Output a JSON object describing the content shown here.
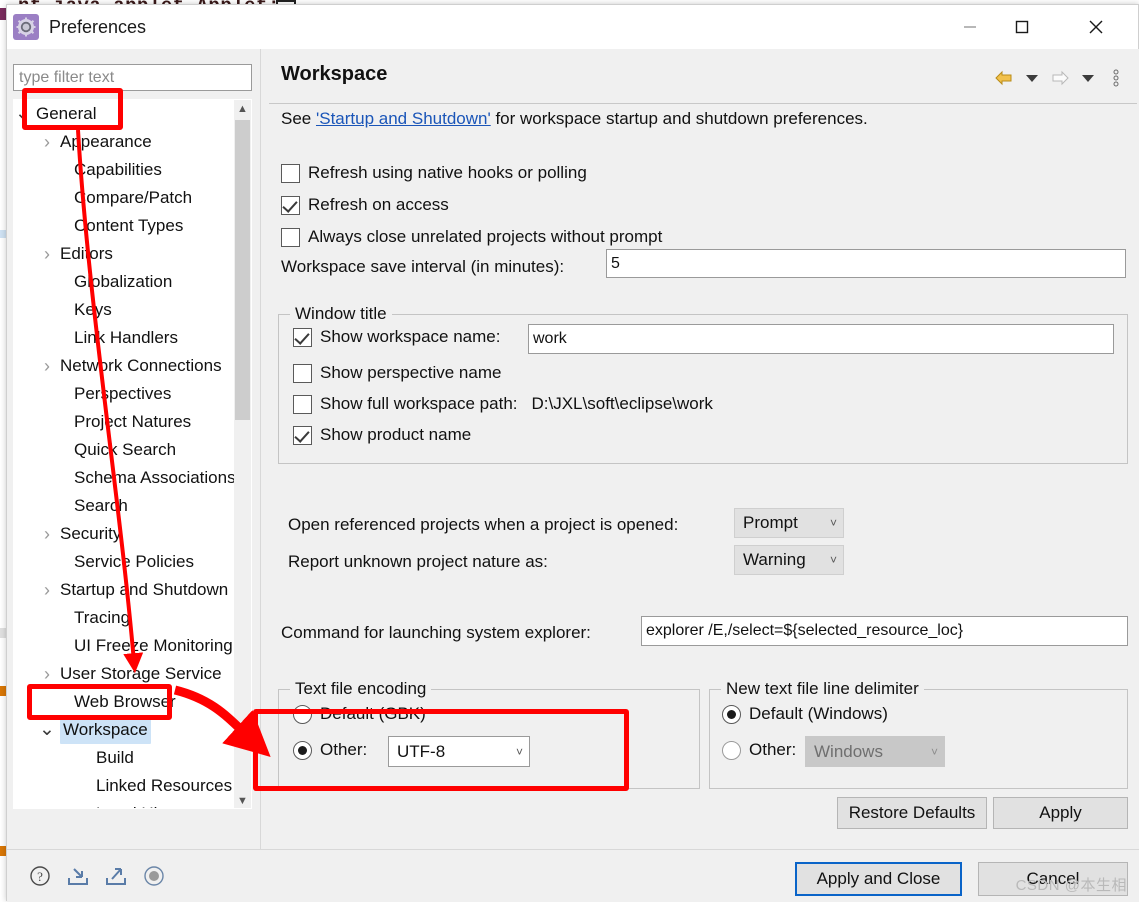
{
  "background": {
    "code_line": "nt java applet Applet;"
  },
  "window": {
    "title": "Preferences",
    "icon": "gear-icon",
    "minimize_label": "—",
    "maximize_label": "□",
    "close_label": "✕"
  },
  "sidebar": {
    "filter_placeholder": "type filter text",
    "filter_value": "",
    "items": [
      {
        "label": "General",
        "indent": 22,
        "twisty": "down",
        "selected": false
      },
      {
        "label": "Appearance",
        "indent": 46,
        "twisty": "right",
        "selected": false
      },
      {
        "label": "Capabilities",
        "indent": 60,
        "twisty": "none",
        "selected": false
      },
      {
        "label": "Compare/Patch",
        "indent": 60,
        "twisty": "none",
        "selected": false
      },
      {
        "label": "Content Types",
        "indent": 60,
        "twisty": "none",
        "selected": false
      },
      {
        "label": "Editors",
        "indent": 46,
        "twisty": "right",
        "selected": false
      },
      {
        "label": "Globalization",
        "indent": 60,
        "twisty": "none",
        "selected": false
      },
      {
        "label": "Keys",
        "indent": 60,
        "twisty": "none",
        "selected": false
      },
      {
        "label": "Link Handlers",
        "indent": 60,
        "twisty": "none",
        "selected": false
      },
      {
        "label": "Network Connections",
        "indent": 46,
        "twisty": "right",
        "selected": false
      },
      {
        "label": "Perspectives",
        "indent": 60,
        "twisty": "none",
        "selected": false
      },
      {
        "label": "Project Natures",
        "indent": 60,
        "twisty": "none",
        "selected": false
      },
      {
        "label": "Quick Search",
        "indent": 60,
        "twisty": "none",
        "selected": false
      },
      {
        "label": "Schema Associations",
        "indent": 60,
        "twisty": "none",
        "selected": false
      },
      {
        "label": "Search",
        "indent": 60,
        "twisty": "none",
        "selected": false
      },
      {
        "label": "Security",
        "indent": 46,
        "twisty": "right",
        "selected": false
      },
      {
        "label": "Service Policies",
        "indent": 60,
        "twisty": "none",
        "selected": false
      },
      {
        "label": "Startup and Shutdown",
        "indent": 46,
        "twisty": "right",
        "selected": false
      },
      {
        "label": "Tracing",
        "indent": 60,
        "twisty": "none",
        "selected": false
      },
      {
        "label": "UI Freeze Monitoring",
        "indent": 60,
        "twisty": "none",
        "selected": false
      },
      {
        "label": "User Storage Service",
        "indent": 46,
        "twisty": "right",
        "selected": false
      },
      {
        "label": "Web Browser",
        "indent": 60,
        "twisty": "none",
        "selected": false
      },
      {
        "label": "Workspace",
        "indent": 46,
        "twisty": "down",
        "selected": true
      },
      {
        "label": "Build",
        "indent": 82,
        "twisty": "none",
        "selected": false
      },
      {
        "label": "Linked Resources",
        "indent": 82,
        "twisty": "none",
        "selected": false
      },
      {
        "label": "Local History",
        "indent": 82,
        "twisty": "none",
        "selected": false
      }
    ]
  },
  "page": {
    "title": "Workspace",
    "description_prefix": "See ",
    "description_link": "'Startup and Shutdown'",
    "description_suffix": " for workspace startup and shutdown preferences.",
    "nav": {
      "back": "back-arrow-icon",
      "back_menu": "chevron-down-icon",
      "forward": "forward-arrow-icon",
      "forward_menu": "chevron-down-icon",
      "menu": "vertical-dots-icon"
    },
    "checkboxes": [
      {
        "label": "Refresh using native hooks or polling",
        "checked": false
      },
      {
        "label": "Refresh on access",
        "checked": true
      },
      {
        "label": "Always close unrelated projects without prompt",
        "checked": false
      }
    ],
    "save_interval": {
      "label": "Workspace save interval (in minutes):",
      "value": "5"
    },
    "window_title_group": {
      "legend": "Window title",
      "show_workspace_name": {
        "label": "Show workspace name:",
        "checked": true,
        "value": "work"
      },
      "show_perspective_name": {
        "label": "Show perspective name",
        "checked": false
      },
      "show_full_workspace_path": {
        "label": "Show full workspace path:",
        "checked": false,
        "value": "D:\\JXL\\soft\\eclipse\\work"
      },
      "show_product_name": {
        "label": "Show product name",
        "checked": true
      }
    },
    "open_referenced": {
      "label": "Open referenced projects when a project is opened:",
      "value": "Prompt"
    },
    "report_nature": {
      "label": "Report unknown project nature as:",
      "value": "Warning"
    },
    "explorer_command": {
      "label": "Command for launching system explorer:",
      "value": "explorer /E,/select=${selected_resource_loc}"
    },
    "text_file_encoding": {
      "legend": "Text file encoding",
      "default_label": "Default (GBK)",
      "default_selected": false,
      "other_label": "Other:",
      "other_selected": true,
      "other_value": "UTF-8"
    },
    "line_delimiter": {
      "legend": "New text file line delimiter",
      "default_label": "Default (Windows)",
      "default_selected": true,
      "other_label": "Other:",
      "other_selected": false,
      "other_value": "Windows"
    },
    "restore_defaults_label": "Restore Defaults",
    "apply_label": "Apply"
  },
  "footer": {
    "help_icon": "question-mark-icon",
    "import_icon": "import-icon",
    "export_icon": "export-icon",
    "record_icon": "record-circle-icon",
    "apply_and_close_label": "Apply and Close",
    "cancel_label": "Cancel"
  },
  "watermark": "CSDN @本生相",
  "colors": {
    "accent": "#0a64c8",
    "link": "#1a55b8",
    "selection": "#cde3f7",
    "annotation": "#ff0000",
    "dialog_bg": "#f0f0f0"
  }
}
